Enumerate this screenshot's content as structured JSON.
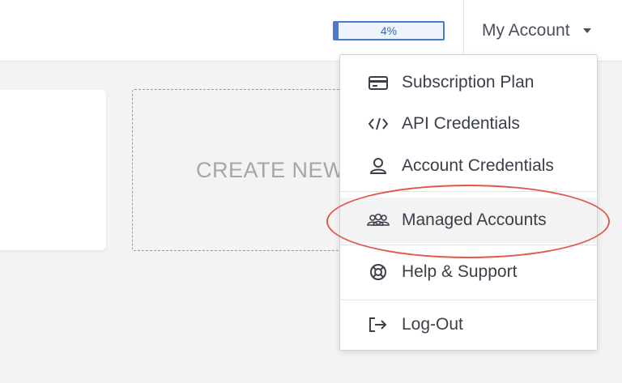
{
  "header": {
    "progress": {
      "text": "4%",
      "value": 0.04,
      "color": "#4a7ad0"
    },
    "account_label": "My Account"
  },
  "main": {
    "create_new_label": "CREATE NEW"
  },
  "menu": {
    "items": [
      {
        "label": "Subscription Plan",
        "icon": "credit-card-icon"
      },
      {
        "label": "API Credentials",
        "icon": "code-icon"
      },
      {
        "label": "Account Credentials",
        "icon": "user-icon"
      },
      {
        "label": "Managed Accounts",
        "icon": "users-group-icon",
        "highlighted": true
      },
      {
        "label": "Help & Support",
        "icon": "lifebuoy-icon"
      },
      {
        "label": "Log-Out",
        "icon": "logout-icon"
      }
    ]
  },
  "annotation": {
    "color": "#e0584a"
  }
}
